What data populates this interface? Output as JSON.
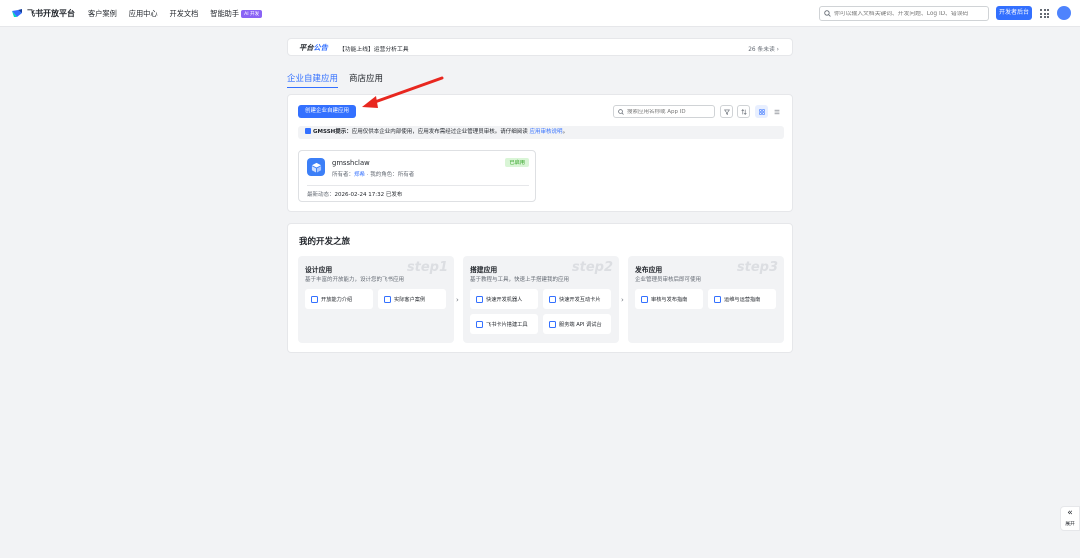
{
  "header": {
    "brand": "飞书开放平台",
    "nav": [
      "客户案例",
      "应用中心",
      "开发文档",
      "智能助手"
    ],
    "ai_badge": "AI 开发",
    "search_placeholder": "你可以输入文档关键词、开发问题、Log ID、错误码",
    "dev_console_label": "开发者后台"
  },
  "notice": {
    "title_part1": "平台",
    "title_part2": "公告",
    "text": "【功能上线】运营分析工具",
    "unread": "26 条未读"
  },
  "tabs": [
    {
      "label": "企业自建应用",
      "active": true
    },
    {
      "label": "商店应用",
      "active": false
    }
  ],
  "apps": {
    "create_label": "创建企业自建应用",
    "search_placeholder": "搜索应用名称或 App ID",
    "tip_prefix": "GMSSH提示：",
    "tip_text": "应用仅供本企业内部使用，应用发布需经过企业管理员审核。请仔细阅读 ",
    "tip_link": "应用审核说明",
    "tip_suffix": "。",
    "list": [
      {
        "name": "gmsshclaw",
        "owner_label": "所有者：",
        "owner": "郑希",
        "role_label": "我的角色：",
        "role": "所有者",
        "status": "已启用",
        "latest_label": "最新动态：",
        "latest_value": "2026-02-24 17:32 已发布"
      }
    ]
  },
  "journey": {
    "title": "我的开发之旅",
    "steps": [
      {
        "title": "设计应用",
        "desc": "基于丰富的开放能力，设计您的飞书应用",
        "watermark": "step1",
        "items": [
          "开放能力介绍",
          "实际客户案例"
        ]
      },
      {
        "title": "搭建应用",
        "desc": "基于教程与工具，快速上手搭建我的应用",
        "watermark": "step2",
        "items": [
          "快速开发机器人",
          "快速开发互动卡片",
          "飞书卡片搭建工具",
          "服务端 API 调试台"
        ]
      },
      {
        "title": "发布应用",
        "desc": "企业管理员审核后即可使用",
        "watermark": "step3",
        "items": [
          "审核与发布指南",
          "运维与运营指南"
        ]
      }
    ]
  },
  "expand_label": "展开",
  "colors": {
    "accent": "#3370ff",
    "annotation_arrow": "#e8271f",
    "status_green": "#2ea121"
  }
}
